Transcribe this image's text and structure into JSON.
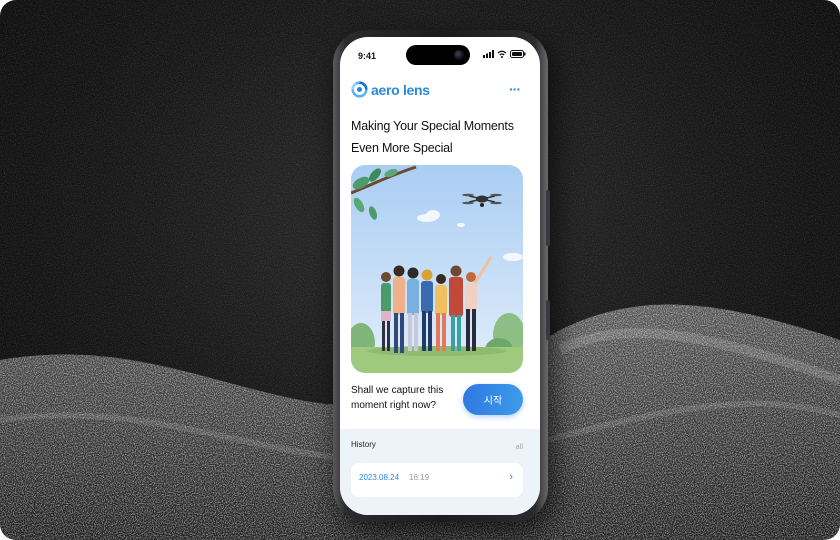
{
  "status_bar": {
    "time": "9:41"
  },
  "app": {
    "logo_text": "aero lens",
    "more_icon": "···"
  },
  "headline": {
    "line1": "Making Your Special Moments",
    "line2": "Even More Special"
  },
  "hero": {
    "illustration": "friends-hugging-with-drone-illustration"
  },
  "cta": {
    "prompt_line1": "Shall we capture this",
    "prompt_line2": "moment right now?",
    "start_label": "시작"
  },
  "history": {
    "title": "History",
    "all_label": "all",
    "items": [
      {
        "date": "2023.08.24",
        "time": "16:19",
        "chevron": "›"
      }
    ]
  },
  "colors": {
    "accent": "#2a8ad8",
    "button": "#2f79e2",
    "history_bg": "#eef3f9"
  }
}
